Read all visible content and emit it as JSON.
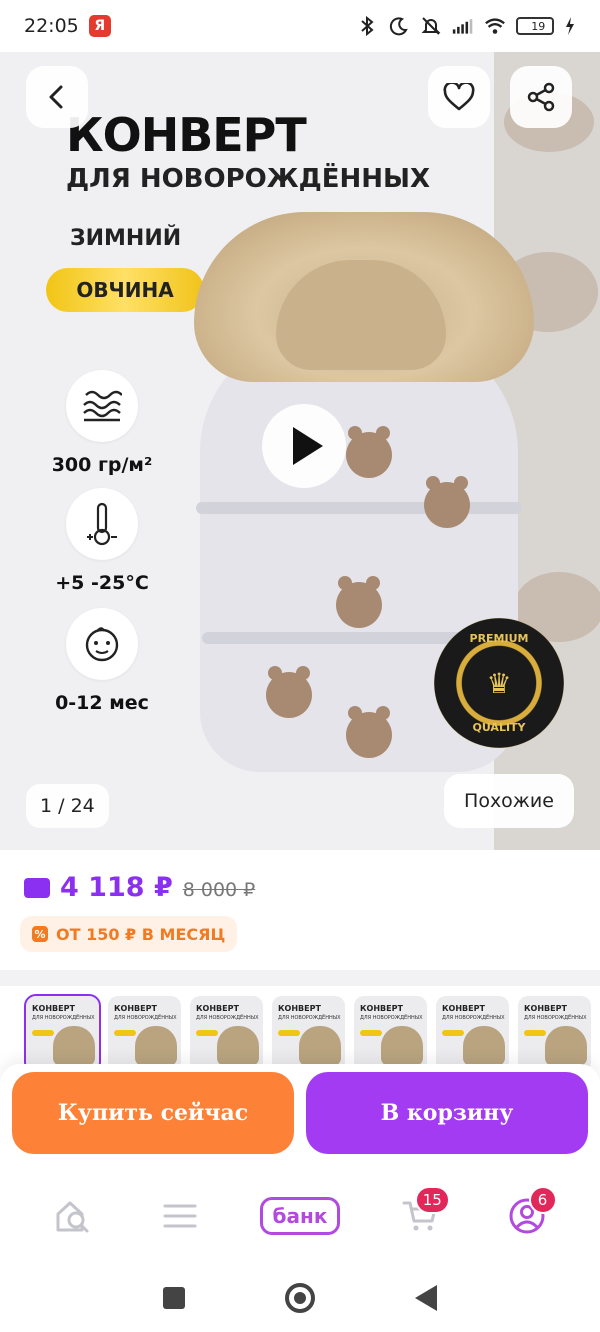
{
  "status_bar": {
    "time": "22:05",
    "yandex_badge": "Я",
    "battery": "19",
    "icons": [
      "bluetooth-icon",
      "moon-icon",
      "mute-icon",
      "signal-icon",
      "wifi-icon",
      "battery-icon",
      "charging-icon"
    ]
  },
  "hero": {
    "title": "КОНВЕРТ",
    "subtitle": "ДЛЯ НОВОРОЖДЁННЫХ",
    "season": "ЗИМНИЙ",
    "material_tag": "ОВЧИНА",
    "specs": [
      {
        "icon": "waves-icon",
        "label": "300 гр/м²"
      },
      {
        "icon": "thermometer-icon",
        "label": "+5 -25°C"
      },
      {
        "icon": "baby-face-icon",
        "label": "0-12 мес"
      }
    ],
    "badge_text_top": "PREMIUM",
    "badge_text_bottom": "QUALITY",
    "counter": "1 / 24",
    "similar_label": "Похожие"
  },
  "price": {
    "current": "4 118 ₽",
    "old": "8 000 ₽",
    "installment": "ОТ 150 ₽ В МЕСЯЦ"
  },
  "thumbnails": {
    "title": "КОНВЕРТ",
    "subtitle": "ДЛЯ НОВОРОЖДЁННЫХ",
    "count": 7
  },
  "actions": {
    "buy_now": "Купить сейчас",
    "add_to_cart": "В корзину"
  },
  "bottom_nav": {
    "bank_label": "банк",
    "cart_count": "15",
    "profile_count": "6"
  },
  "colors": {
    "accent_purple": "#a23bf2",
    "accent_orange": "#fd8137",
    "price_purple": "#8b2ff0",
    "badge_red": "#e0285a"
  }
}
